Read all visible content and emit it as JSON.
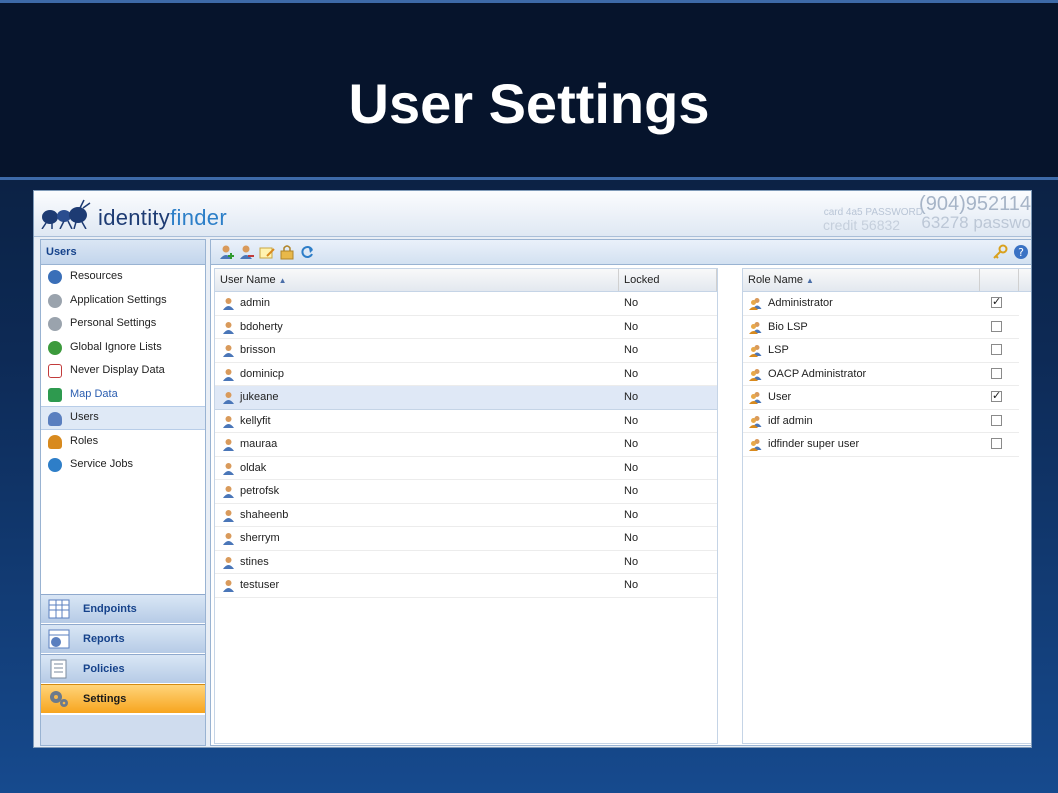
{
  "slide": {
    "title": "User Settings"
  },
  "app": {
    "logo": {
      "brand_a": "identity",
      "brand_b": "finder"
    },
    "banner": {
      "line_phone": "(904)952114",
      "line_card": "card 4a5 PASSWORD",
      "line_pw": "63278 passwo",
      "line_credit": "credit 56832"
    }
  },
  "sidebar": {
    "header": "Users",
    "items": [
      {
        "label": "Resources",
        "icon": "info-icon",
        "color": "#3a6fb8"
      },
      {
        "label": "Application Settings",
        "icon": "gear-icon",
        "color": "#9aa3ad"
      },
      {
        "label": "Personal Settings",
        "icon": "gear-icon",
        "color": "#9aa3ad"
      },
      {
        "label": "Global Ignore Lists",
        "icon": "globe-icon",
        "color": "#3c9a3c"
      },
      {
        "label": "Never Display Data",
        "icon": "document-icon",
        "color": "#c23b3b"
      },
      {
        "label": "Map Data",
        "icon": "map-arrows-icon",
        "color": "#2e9a4f"
      },
      {
        "label": "Users",
        "icon": "users-icon",
        "color": "#5a7fbf"
      },
      {
        "label": "Roles",
        "icon": "roles-icon",
        "color": "#d88a1e"
      },
      {
        "label": "Service Jobs",
        "icon": "clock-icon",
        "color": "#2e7ec8"
      }
    ],
    "accordion": [
      {
        "label": "Endpoints",
        "icon": "endpoints-icon"
      },
      {
        "label": "Reports",
        "icon": "reports-icon"
      },
      {
        "label": "Policies",
        "icon": "policies-icon"
      },
      {
        "label": "Settings",
        "icon": "settings-gear-icon"
      }
    ]
  },
  "toolbar": {
    "buttons": [
      "add-user-icon",
      "remove-user-icon",
      "edit-icon",
      "lock-icon",
      "refresh-icon"
    ],
    "right": [
      "key-icon",
      "help-icon"
    ]
  },
  "users_grid": {
    "columns": [
      "User Name",
      "Locked"
    ],
    "rows": [
      {
        "name": "admin",
        "locked": "No"
      },
      {
        "name": "bdoherty",
        "locked": "No"
      },
      {
        "name": "brisson",
        "locked": "No"
      },
      {
        "name": "dominicp",
        "locked": "No"
      },
      {
        "name": "jukeane",
        "locked": "No"
      },
      {
        "name": "kellyfit",
        "locked": "No"
      },
      {
        "name": "mauraa",
        "locked": "No"
      },
      {
        "name": "oldak",
        "locked": "No"
      },
      {
        "name": "petrofsk",
        "locked": "No"
      },
      {
        "name": "shaheenb",
        "locked": "No"
      },
      {
        "name": "sherrym",
        "locked": "No"
      },
      {
        "name": "stines",
        "locked": "No"
      },
      {
        "name": "testuser",
        "locked": "No"
      }
    ]
  },
  "roles_grid": {
    "columns": [
      "Role Name",
      ""
    ],
    "rows": [
      {
        "name": "Administrator",
        "checked": true
      },
      {
        "name": "Bio LSP",
        "checked": false
      },
      {
        "name": "LSP",
        "checked": false
      },
      {
        "name": "OACP Administrator",
        "checked": false
      },
      {
        "name": "User",
        "checked": true
      },
      {
        "name": "idf admin",
        "checked": false
      },
      {
        "name": "idfinder super user",
        "checked": false
      }
    ]
  }
}
